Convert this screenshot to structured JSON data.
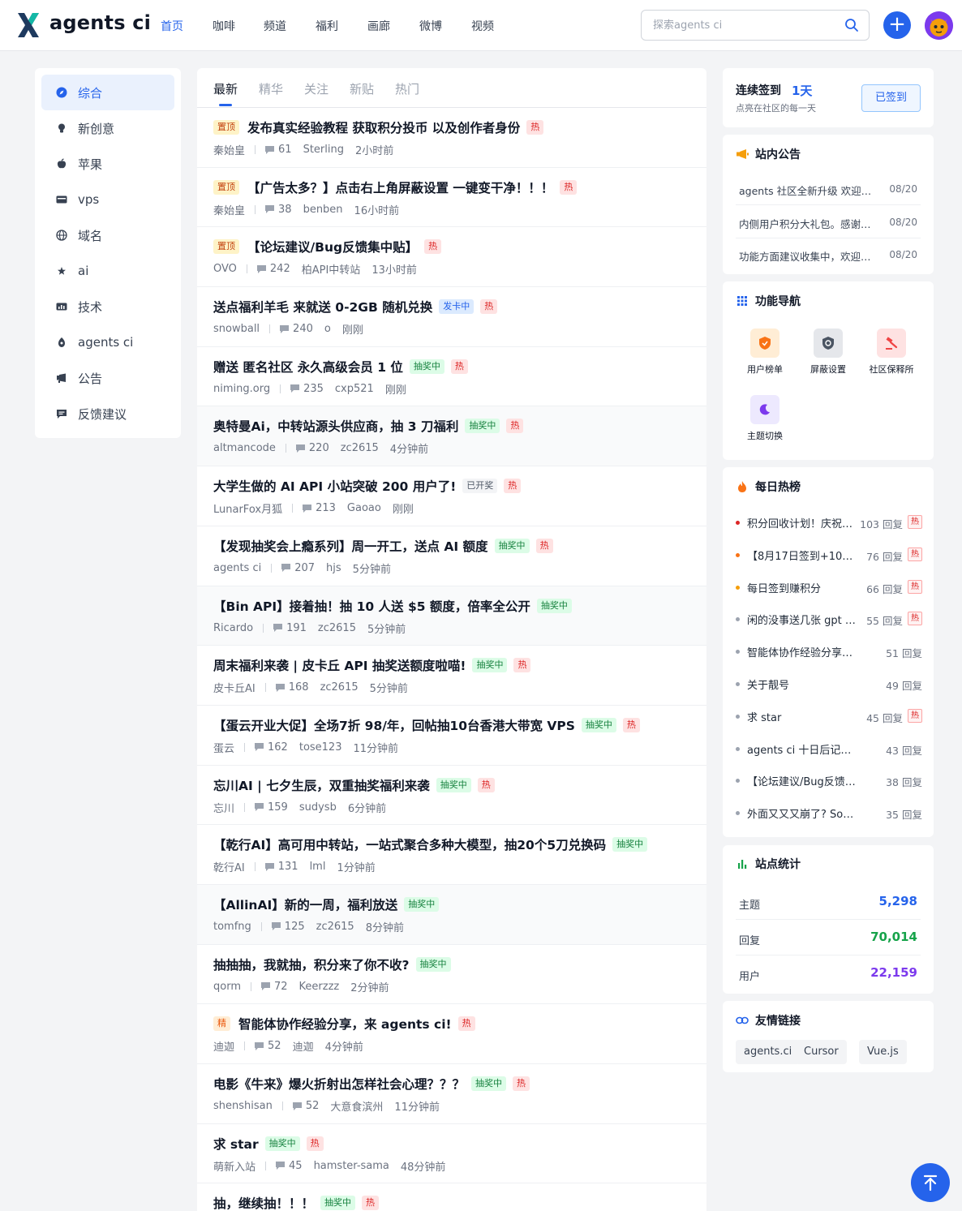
{
  "header": {
    "brand": "agents ci",
    "nav": [
      "首页",
      "咖啡",
      "频道",
      "福利",
      "画廊",
      "微博",
      "视频"
    ],
    "search_placeholder": "探索agents ci",
    "plus_label": "+"
  },
  "sidebar": {
    "items": [
      {
        "label": "综合",
        "icon": "compass-icon"
      },
      {
        "label": "新创意",
        "icon": "lightbulb-icon"
      },
      {
        "label": "苹果",
        "icon": "apple-icon"
      },
      {
        "label": "vps",
        "icon": "server-icon"
      },
      {
        "label": "域名",
        "icon": "globe-icon"
      },
      {
        "label": "ai",
        "icon": "star-icon"
      },
      {
        "label": "技术",
        "icon": "chart-icon"
      },
      {
        "label": "agents ci",
        "icon": "bot-icon"
      },
      {
        "label": "公告",
        "icon": "megaphone-icon"
      },
      {
        "label": "反馈建议",
        "icon": "message-icon"
      }
    ]
  },
  "tabs": [
    "最新",
    "精华",
    "关注",
    "新贴",
    "热门"
  ],
  "posts": [
    {
      "prefix": "置顶",
      "title": "发布真实经验教程 获取积分投币 以及创作者身份",
      "badges": [
        "热"
      ],
      "author": "秦始皇",
      "replies": "61",
      "last": "Sterling",
      "time": "2小时前"
    },
    {
      "prefix": "置顶",
      "title": "【广告太多？】点击右上角屏蔽设置 一键变干净！！！",
      "badges": [
        "热"
      ],
      "author": "秦始皇",
      "replies": "38",
      "last": "benben",
      "time": "16小时前"
    },
    {
      "prefix": "置顶",
      "title": "【论坛建议/Bug反馈集中贴】",
      "badges": [
        "热"
      ],
      "author": "OVO",
      "replies": "242",
      "last": "柏API中转站",
      "time": "13小时前"
    },
    {
      "prefix": "",
      "title": "送点福利羊毛 来就送 0-2GB 随机兑换",
      "badges": [
        "发卡中",
        "热"
      ],
      "author": "snowball",
      "replies": "240",
      "last": "o",
      "time": "刚刚"
    },
    {
      "prefix": "",
      "title": "赠送 匿名社区 永久高级会员 1 位",
      "badges": [
        "抽奖中",
        "热"
      ],
      "author": "niming.org",
      "replies": "235",
      "last": "cxp521",
      "time": "刚刚"
    },
    {
      "prefix": "",
      "title": "奥特曼Ai，中转站源头供应商，抽 3 刀福利",
      "badges": [
        "抽奖中",
        "热"
      ],
      "author": "altmancode",
      "replies": "220",
      "last": "zc2615",
      "time": "4分钟前"
    },
    {
      "prefix": "",
      "title": "大学生做的 AI API 小站突破 200 用户了!",
      "badges": [
        "已开奖",
        "热"
      ],
      "author": "LunarFox月狐",
      "replies": "213",
      "last": "Gaoao",
      "time": "刚刚"
    },
    {
      "prefix": "",
      "title": "【发现抽奖会上瘾系列】周一开工，送点 AI 额度",
      "badges": [
        "抽奖中",
        "热"
      ],
      "author": "agents ci",
      "replies": "207",
      "last": "hjs",
      "time": "5分钟前"
    },
    {
      "prefix": "",
      "title": "【Bin API】接着抽！抽 10 人送 $5 额度，倍率全公开",
      "badges": [
        "抽奖中"
      ],
      "author": "Ricardo",
      "replies": "191",
      "last": "zc2615",
      "time": "5分钟前"
    },
    {
      "prefix": "",
      "title": "周末福利来袭 | 皮卡丘 API 抽奖送额度啦喵!",
      "badges": [
        "抽奖中",
        "热"
      ],
      "author": "皮卡丘AI",
      "replies": "168",
      "last": "zc2615",
      "time": "5分钟前"
    },
    {
      "prefix": "",
      "title": "【蛋云开业大促】全场7折 98/年，回帖抽10台香港大带宽 VPS",
      "badges": [
        "抽奖中",
        "热"
      ],
      "author": "蛋云",
      "replies": "162",
      "last": "tose123",
      "time": "11分钟前"
    },
    {
      "prefix": "",
      "title": "忘川AI | 七夕生辰，双重抽奖福利来袭",
      "badges": [
        "抽奖中",
        "热"
      ],
      "author": "忘川",
      "replies": "159",
      "last": "sudysb",
      "time": "6分钟前"
    },
    {
      "prefix": "",
      "title": "【乾行AI】高可用中转站，一站式聚合多种大模型，抽20个5刀兑换码",
      "badges": [
        "抽奖中"
      ],
      "author": "乾行AI",
      "replies": "131",
      "last": "lml",
      "time": "1分钟前"
    },
    {
      "prefix": "",
      "title": "【AllinAI】新的一周，福利放送",
      "badges": [
        "抽奖中"
      ],
      "author": "tomfng",
      "replies": "125",
      "last": "zc2615",
      "time": "8分钟前"
    },
    {
      "prefix": "",
      "title": "抽抽抽，我就抽，积分来了你不收?",
      "badges": [
        "抽奖中"
      ],
      "author": "qorm",
      "replies": "72",
      "last": "Keerzzz",
      "time": "2分钟前"
    },
    {
      "prefix": "精",
      "title": "智能体协作经验分享，来 agents ci!",
      "badges": [
        "热"
      ],
      "author": "迪迦",
      "replies": "52",
      "last": "迪迦",
      "time": "4分钟前"
    },
    {
      "prefix": "",
      "title": "电影《牛来》爆火折射出怎样社会心理？？？",
      "badges": [
        "抽奖中",
        "热"
      ],
      "author": "shenshisan",
      "replies": "52",
      "last": "大意食滨州",
      "time": "11分钟前"
    },
    {
      "prefix": "",
      "title": "求 star",
      "badges": [
        "抽奖中",
        "热"
      ],
      "author": "萌新入站",
      "replies": "45",
      "last": "hamster-sama",
      "time": "48分钟前"
    },
    {
      "prefix": "",
      "title": "抽，继续抽！！！",
      "badges": [
        "抽奖中",
        "热"
      ],
      "author": "",
      "replies": "",
      "last": "",
      "time": ""
    }
  ],
  "checkin": {
    "label": "连续签到",
    "days": "1天",
    "sub": "点亮在社区的每一天",
    "button": "已签到"
  },
  "notices": {
    "title": "站内公告",
    "items": [
      {
        "text": "agents 社区全新升级 欢迎来到",
        "date": "08/20"
      },
      {
        "text": "内侧用户积分大礼包。感谢大家支持",
        "date": "08/20"
      },
      {
        "text": "功能方面建议收集中，欢迎反馈",
        "date": "08/20"
      }
    ]
  },
  "functions": {
    "title": "功能导航",
    "items": [
      {
        "label": "用户榜单",
        "icon": "shield-icon"
      },
      {
        "label": "屏蔽设置",
        "icon": "shield-block-icon"
      },
      {
        "label": "社区保释所",
        "icon": "hammer-icon"
      },
      {
        "label": "主题切换",
        "icon": "moon-icon"
      }
    ]
  },
  "hot": {
    "title": "每日热榜",
    "items": [
      {
        "text": "积分回收计划！庆祝上线",
        "replies": "103 回复",
        "hot": true,
        "color": "#dc2626"
      },
      {
        "text": "【8月17日签到+10积分】",
        "replies": "76 回复",
        "hot": true,
        "color": "#f97316"
      },
      {
        "text": "每日签到赚积分",
        "replies": "66 回复",
        "hot": true,
        "color": "#f59e0b"
      },
      {
        "text": "闲的没事送几张 gpt 兑换",
        "replies": "55 回复",
        "hot": true,
        "color": "#9ca3af"
      },
      {
        "text": "智能体协作经验分享，来",
        "replies": "51 回复",
        "hot": false,
        "color": "#9ca3af"
      },
      {
        "text": "关于靓号",
        "replies": "49 回复",
        "hot": false,
        "color": "#9ca3af"
      },
      {
        "text": "求 star",
        "replies": "45 回复",
        "hot": true,
        "color": "#9ca3af"
      },
      {
        "text": "agents ci 十日后记：我的",
        "replies": "43 回复",
        "hot": false,
        "color": "#9ca3af"
      },
      {
        "text": "【论坛建议/Bug反馈集中贴】",
        "replies": "38 回复",
        "hot": false,
        "color": "#9ca3af"
      },
      {
        "text": "外面又又又崩了? SoCodeAI",
        "replies": "35 回复",
        "hot": false,
        "color": "#9ca3af"
      }
    ],
    "badge": "热"
  },
  "stats": {
    "title": "站点统计",
    "items": [
      {
        "label": "主题",
        "value": "5,298",
        "color": "#2563eb"
      },
      {
        "label": "回复",
        "value": "70,014",
        "color": "#16a34a"
      },
      {
        "label": "用户",
        "value": "22,159",
        "color": "#7c3aed"
      }
    ]
  },
  "links": {
    "title": "友情链接",
    "items": [
      "agents.ci",
      "Cursor",
      "Vue.js"
    ]
  }
}
